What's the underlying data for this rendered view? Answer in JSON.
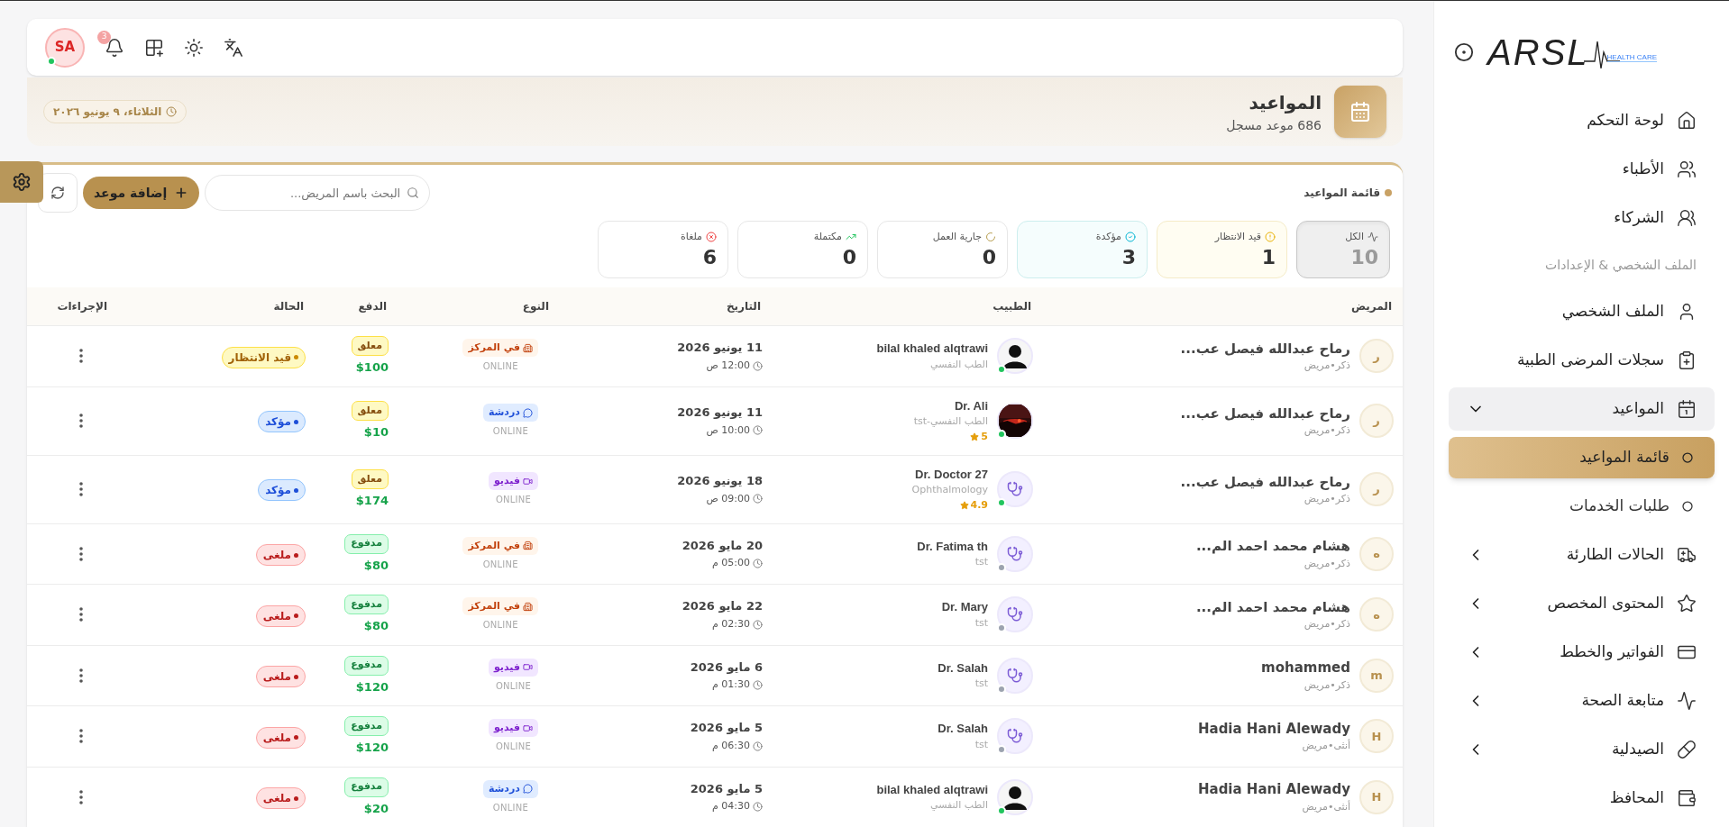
{
  "sidebar": {
    "logo": {
      "text": "ARSL",
      "tagline": "HEALTH CARE"
    },
    "items": [
      {
        "kind": "link",
        "label": "لوحة التحكم"
      },
      {
        "kind": "link",
        "label": "الأطباء"
      },
      {
        "kind": "link",
        "label": "الشركاء"
      },
      {
        "kind": "section",
        "label": "الملف الشخصي & الإعدادات"
      },
      {
        "kind": "link",
        "label": "الملف الشخصي"
      },
      {
        "kind": "link",
        "label": "سجلات المرضى الطبية"
      },
      {
        "kind": "group",
        "label": "المواعيد",
        "expanded": true,
        "children": [
          {
            "label": "قائمة المواعيد",
            "selected": true
          },
          {
            "label": "طلبات الخدمات",
            "selected": false
          }
        ]
      },
      {
        "kind": "group",
        "label": "الحالات الطارئة",
        "expanded": false
      },
      {
        "kind": "group",
        "label": "المحتوى المخصص",
        "expanded": false
      },
      {
        "kind": "group",
        "label": "الفواتير والخطط",
        "expanded": false
      },
      {
        "kind": "group",
        "label": "متابعة الصحة",
        "expanded": false
      },
      {
        "kind": "group",
        "label": "الصيدلية",
        "expanded": false
      },
      {
        "kind": "link",
        "label": "المحافظ"
      }
    ]
  },
  "topbar": {
    "avatar": "SA",
    "online": true,
    "notifications": "3"
  },
  "header": {
    "title": "المواعيد",
    "subtitle": "686 موعد مسجل",
    "date": "الثلاثاء، ٩ يونيو ٢٠٢٦"
  },
  "list": {
    "title": "قائمة المواعيد",
    "search": {
      "placeholder": "البحث باسم المريض..."
    },
    "add_button": "إضافة موعد",
    "stats": [
      {
        "kind": "all",
        "label": "الكل",
        "value": "10",
        "selected": true
      },
      {
        "kind": "pending",
        "label": "قيد الانتظار",
        "value": "1",
        "selected": false
      },
      {
        "kind": "confirmed",
        "label": "مؤكدة",
        "value": "3",
        "selected": false
      },
      {
        "kind": "progress",
        "label": "جارية العمل",
        "value": "0",
        "selected": false
      },
      {
        "kind": "completed",
        "label": "مكتملة",
        "value": "0",
        "selected": false
      },
      {
        "kind": "cancelled",
        "label": "ملغاة",
        "value": "6",
        "selected": false
      }
    ],
    "columns": [
      "المريض",
      "الطبيب",
      "التاريخ",
      "النوع",
      "الدفع",
      "الحالة",
      "الإجراءات"
    ],
    "rows": [
      {
        "patient": {
          "initial": "ر",
          "name": "رماح عبدالله فيصل عب...",
          "meta": "ذكر•مريض"
        },
        "doctor": {
          "kind": "silhouette",
          "name": "bilal khaled alqtrawi",
          "specialty": "الطب النفسي",
          "online": true
        },
        "date": "11 يونيو 2026",
        "time": "12:00 ص",
        "type": {
          "kind": "center",
          "label": "في المركز"
        },
        "mode": "ONLINE",
        "payment": {
          "kind": "pending",
          "label": "معلق",
          "amount": "$100"
        },
        "status": {
          "kind": "waiting",
          "label": "قيد الانتظار"
        }
      },
      {
        "patient": {
          "initial": "ر",
          "name": "رماح عبدالله فيصل عب...",
          "meta": "ذكر•مريض"
        },
        "doctor": {
          "name": "Dr. Ali",
          "specialty": "الطب النفسي-tst",
          "rating": "5",
          "online": true
        },
        "date": "11 يونيو 2026",
        "time": "10:00 ص",
        "type": {
          "kind": "chat",
          "label": "دردشة"
        },
        "mode": "ONLINE",
        "payment": {
          "kind": "pending",
          "label": "معلق",
          "amount": "$10"
        },
        "status": {
          "kind": "confirmed",
          "label": "مؤكد"
        }
      },
      {
        "patient": {
          "initial": "ر",
          "name": "رماح عبدالله فيصل عب...",
          "meta": "ذكر•مريض"
        },
        "doctor": {
          "kind": "stethoscope",
          "name": "Dr. Doctor 27",
          "specialty": "Ophthalmology",
          "rating": "4.9",
          "online": true
        },
        "date": "18 يونيو 2026",
        "time": "09:00 ص",
        "type": {
          "kind": "video",
          "label": "فيديو"
        },
        "mode": "ONLINE",
        "payment": {
          "kind": "pending",
          "label": "معلق",
          "amount": "$174"
        },
        "status": {
          "kind": "confirmed",
          "label": "مؤكد"
        }
      },
      {
        "patient": {
          "initial": "ه",
          "name": "هشام محمد احمد الم...",
          "meta": "ذكر•مريض"
        },
        "doctor": {
          "kind": "stethoscope",
          "name": "Dr. Fatima th",
          "specialty": "tst",
          "online": false
        },
        "date": "20 مايو 2026",
        "time": "05:00 م",
        "type": {
          "kind": "center",
          "label": "في المركز"
        },
        "mode": "ONLINE",
        "payment": {
          "kind": "paid",
          "label": "مدفوع",
          "amount": "$80"
        },
        "status": {
          "kind": "cancelled",
          "label": "ملغى"
        }
      },
      {
        "patient": {
          "initial": "ه",
          "name": "هشام محمد احمد الم...",
          "meta": "ذكر•مريض"
        },
        "doctor": {
          "kind": "stethoscope",
          "name": "Dr. Mary",
          "specialty": "tst",
          "online": false
        },
        "date": "22 مايو 2026",
        "time": "02:30 م",
        "type": {
          "kind": "center",
          "label": "في المركز"
        },
        "mode": "ONLINE",
        "payment": {
          "kind": "paid",
          "label": "مدفوع",
          "amount": "$80"
        },
        "status": {
          "kind": "cancelled",
          "label": "ملغى"
        }
      },
      {
        "patient": {
          "initial": "m",
          "name": "mohammed",
          "meta": "ذكر•مريض"
        },
        "doctor": {
          "kind": "stethoscope",
          "name": "Dr. Salah",
          "specialty": "tst",
          "online": false
        },
        "date": "6 مايو 2026",
        "time": "01:30 م",
        "type": {
          "kind": "video",
          "label": "فيديو"
        },
        "mode": "ONLINE",
        "payment": {
          "kind": "paid",
          "label": "مدفوع",
          "amount": "$120"
        },
        "status": {
          "kind": "cancelled",
          "label": "ملغى"
        }
      },
      {
        "patient": {
          "initial": "H",
          "name": "Hadia Hani Alewady",
          "meta": "أنثى•مريض"
        },
        "doctor": {
          "kind": "stethoscope",
          "name": "Dr. Salah",
          "specialty": "tst",
          "online": false
        },
        "date": "5 مايو 2026",
        "time": "06:30 م",
        "type": {
          "kind": "video",
          "label": "فيديو"
        },
        "mode": "ONLINE",
        "payment": {
          "kind": "paid",
          "label": "مدفوع",
          "amount": "$120"
        },
        "status": {
          "kind": "cancelled",
          "label": "ملغى"
        }
      },
      {
        "patient": {
          "initial": "H",
          "name": "Hadia Hani Alewady",
          "meta": "أنثى•مريض"
        },
        "doctor": {
          "kind": "silhouette",
          "name": "bilal khaled alqtrawi",
          "specialty": "الطب النفسي",
          "online": true
        },
        "date": "5 مايو 2026",
        "time": "04:30 م",
        "type": {
          "kind": "chat",
          "label": "دردشة"
        },
        "mode": "ONLINE",
        "payment": {
          "kind": "paid",
          "label": "مدفوع",
          "amount": "$20"
        },
        "status": {
          "kind": "cancelled",
          "label": "ملغى"
        }
      }
    ]
  }
}
